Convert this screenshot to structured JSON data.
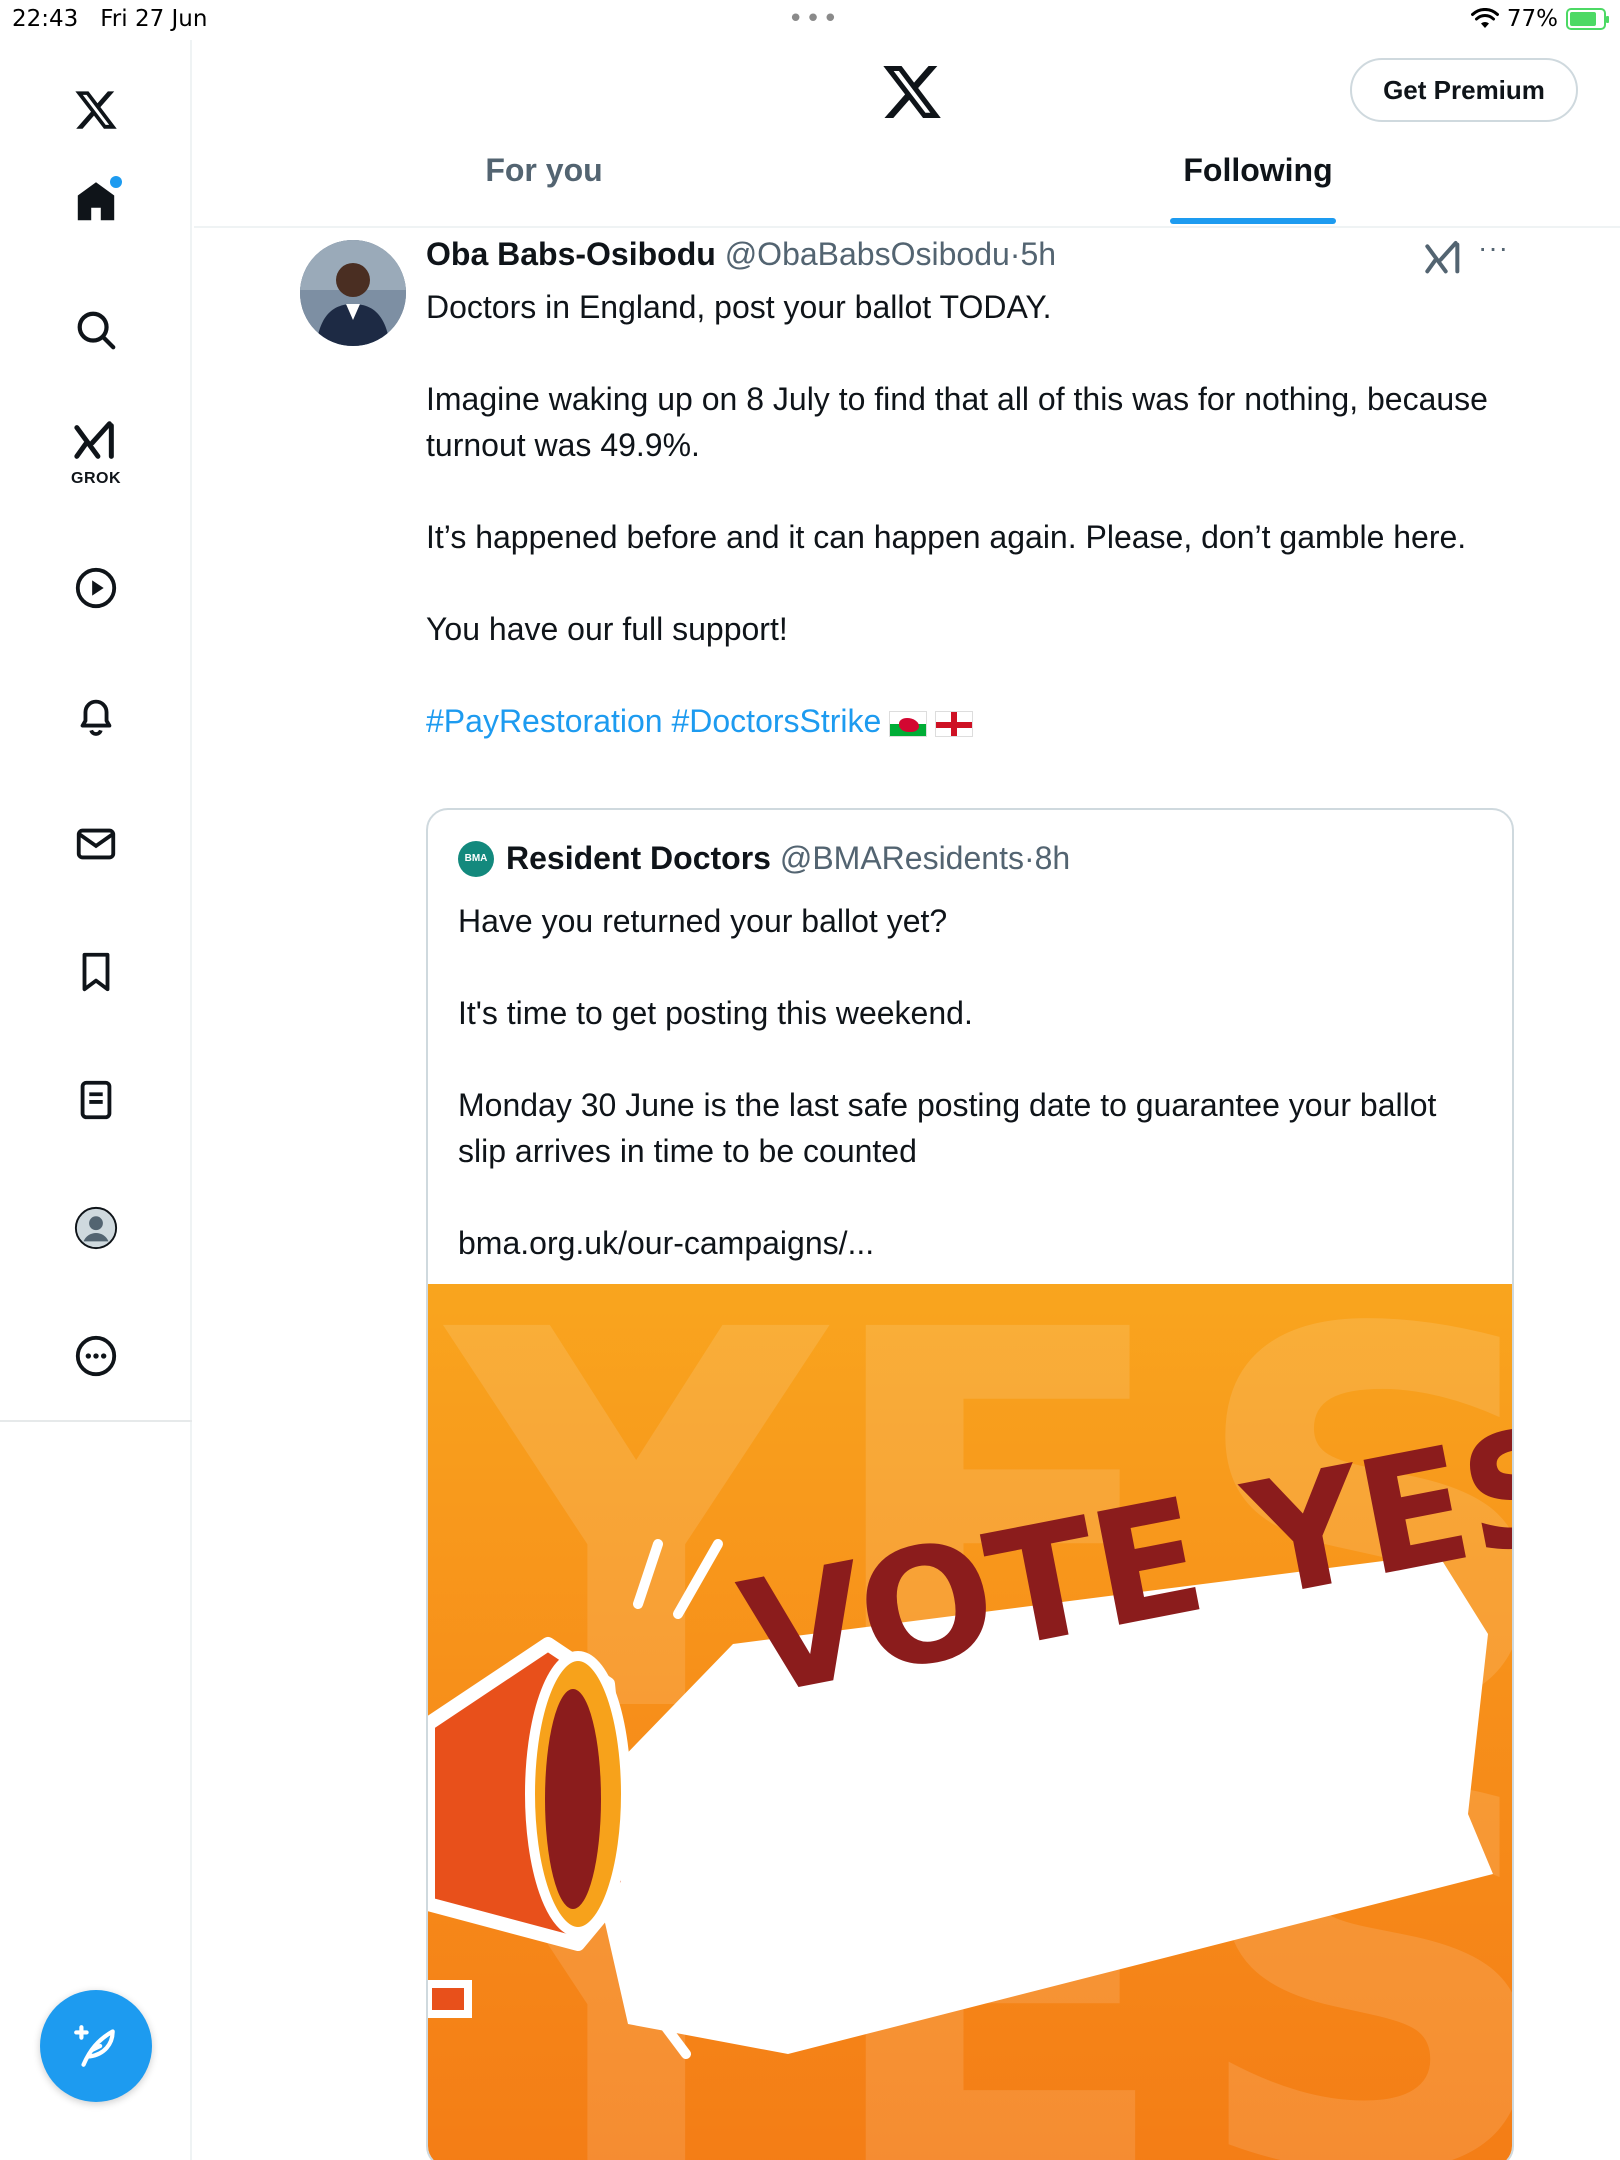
{
  "status_bar": {
    "time": "22:43",
    "date": "Fri 27 Jun",
    "dots": "•••",
    "battery": "77%"
  },
  "sidebar": {
    "items": [
      {
        "icon": "x-logo-icon"
      },
      {
        "icon": "home-icon",
        "has_notification_dot": true
      },
      {
        "icon": "search-icon"
      },
      {
        "icon": "grok-icon",
        "label": "GROK"
      },
      {
        "icon": "video-play-icon"
      },
      {
        "icon": "bell-icon"
      },
      {
        "icon": "mail-icon"
      },
      {
        "icon": "bookmark-icon"
      },
      {
        "icon": "list-icon"
      },
      {
        "icon": "profile-avatar-icon"
      },
      {
        "icon": "more-circle-icon"
      }
    ],
    "compose_icon": "compose-feather-icon"
  },
  "header": {
    "logo": "x-logo-icon",
    "premium_label": "Get Premium",
    "tabs": [
      {
        "label": "For you",
        "active": false
      },
      {
        "label": "Following",
        "active": true
      }
    ]
  },
  "tweet": {
    "author_name": "Oba Babs-Osibodu",
    "handle": "@ObaBabsOsibodu",
    "separator": "·",
    "ago": "5h",
    "more": "···",
    "paragraphs": [
      "Doctors in England, post your ballot TODAY.",
      "Imagine waking up on 8 July to find that all of this was for nothing, because turnout was 49.9%.",
      "It’s happened before and it can happen again. Please, don’t gamble here.",
      "You have our full support!"
    ],
    "hashtags": "#PayRestoration #DoctorsStrike",
    "quote": {
      "logo_text": "BMA",
      "author_name": "Resident Doctors",
      "handle": "@BMAResidents",
      "separator": "·",
      "ago": "8h",
      "paragraphs": [
        "Have you returned your ballot yet?",
        "It's time to get posting this weekend.",
        "Monday 30 June is the last safe posting date to guarantee your ballot slip arrives in time to be counted",
        "bma.org.uk/our-campaigns/..."
      ],
      "image": {
        "headline": "VOTE YES",
        "background_letters": "YES",
        "bg_color": "#f7901a",
        "text_color": "#8b1c1c"
      }
    }
  },
  "colors": {
    "accent": "#1d9bf0",
    "text_primary": "#0f1419",
    "text_secondary": "#536471"
  }
}
